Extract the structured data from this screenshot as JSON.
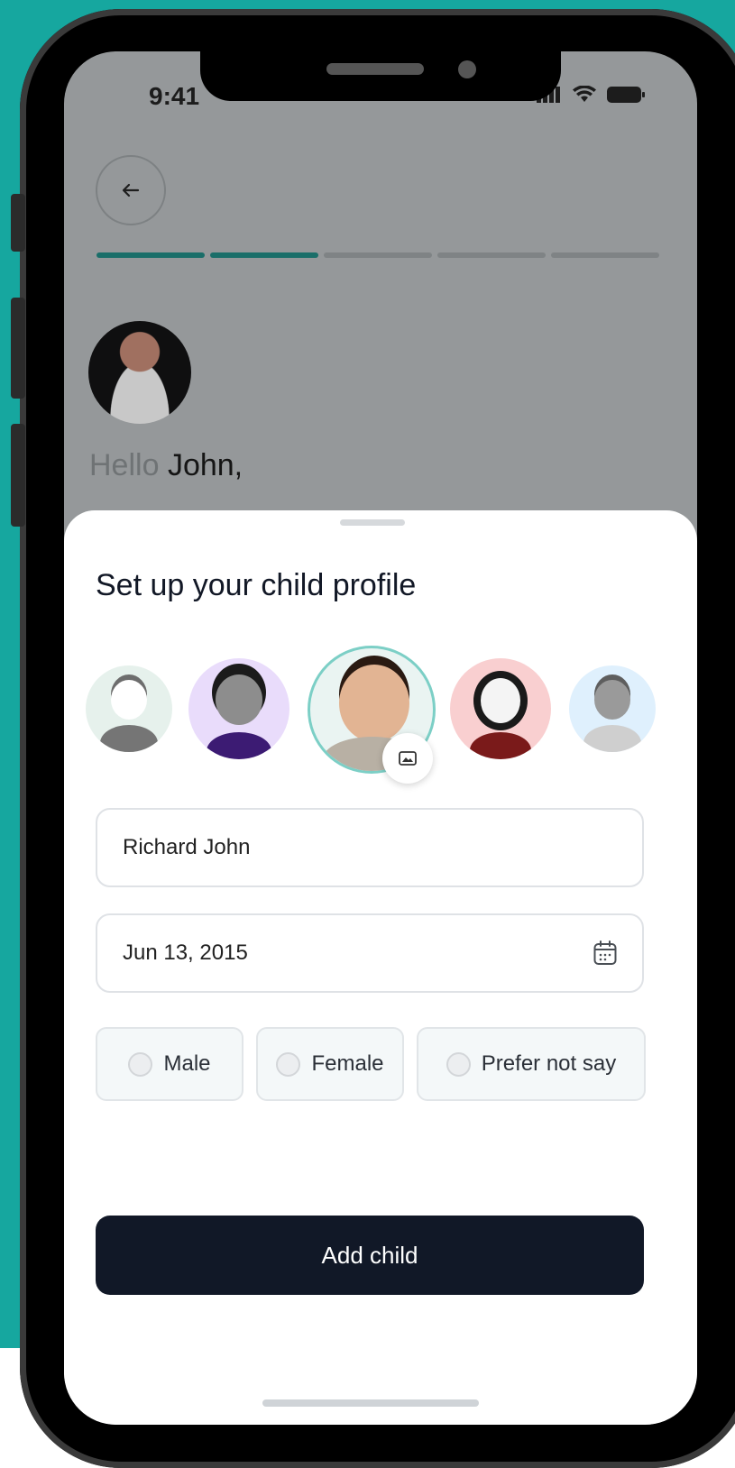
{
  "status_bar": {
    "time": "9:41"
  },
  "header": {
    "back_icon": "arrow-left-icon",
    "progress_steps_total": 5,
    "progress_steps_done": 2
  },
  "greeting": {
    "hello": "Hello",
    "name": "John,"
  },
  "sheet": {
    "title": "Set up your child profile",
    "avatars": [
      "boy-avatar",
      "curly-hair-avatar",
      "child-photo",
      "girl-avatar",
      "short-hair-avatar"
    ],
    "selected_avatar": "child-photo",
    "name_field": {
      "value": "Richard John"
    },
    "dob_field": {
      "value": "Jun 13, 2015",
      "icon": "calendar-icon"
    },
    "gender_options": [
      "Male",
      "Female",
      "Prefer not say"
    ],
    "submit_label": "Add child"
  },
  "colors": {
    "background": "#16a79f",
    "progress_done": "#1a6e69",
    "button": "#111827"
  }
}
